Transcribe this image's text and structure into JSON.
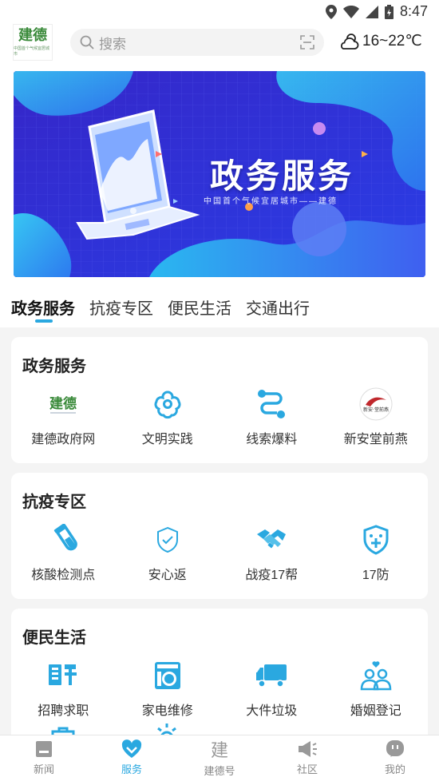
{
  "status_bar": {
    "time": "8:47"
  },
  "header": {
    "logo_text": "建德",
    "logo_sub": "中国首个气候宜居城市",
    "search_placeholder": "搜索",
    "weather": "16~22℃"
  },
  "banner": {
    "title": "政务服务",
    "subtitle": "中国首个气候宜居城市——建德"
  },
  "tabs": [
    {
      "label": "政务服务",
      "active": true
    },
    {
      "label": "抗疫专区",
      "active": false
    },
    {
      "label": "便民生活",
      "active": false
    },
    {
      "label": "交通出行",
      "active": false
    }
  ],
  "sections": [
    {
      "title": "政务服务",
      "items": [
        {
          "label": "建德政府网",
          "icon": "jiande-logo-icon"
        },
        {
          "label": "文明实践",
          "icon": "flower-icon"
        },
        {
          "label": "线索爆料",
          "icon": "route-icon"
        },
        {
          "label": "新安堂前燕",
          "icon": "xinantang-logo-icon"
        }
      ]
    },
    {
      "title": "抗疫专区",
      "items": [
        {
          "label": "核酸检测点",
          "icon": "test-tube-icon"
        },
        {
          "label": "安心返",
          "icon": "shield-check-icon"
        },
        {
          "label": "战疫17帮",
          "icon": "handshake-icon"
        },
        {
          "label": "17防",
          "icon": "shield-plus-icon"
        }
      ]
    },
    {
      "title": "便民生活",
      "items": [
        {
          "label": "招聘求职",
          "icon": "recruit-icon"
        },
        {
          "label": "家电维修",
          "icon": "washing-machine-icon"
        },
        {
          "label": "大件垃圾",
          "icon": "truck-icon"
        },
        {
          "label": "婚姻登记",
          "icon": "couple-icon"
        }
      ]
    }
  ],
  "bottom_nav": [
    {
      "label": "新闻",
      "icon": "news-icon",
      "active": false
    },
    {
      "label": "服务",
      "icon": "heart-icon",
      "active": true
    },
    {
      "label": "建德号",
      "icon": "jiande-icon",
      "active": false
    },
    {
      "label": "社区",
      "icon": "megaphone-icon",
      "active": false
    },
    {
      "label": "我的",
      "icon": "profile-icon",
      "active": false
    }
  ],
  "colors": {
    "accent": "#2aa8e0",
    "banner_bg": "#2f2fd8"
  }
}
